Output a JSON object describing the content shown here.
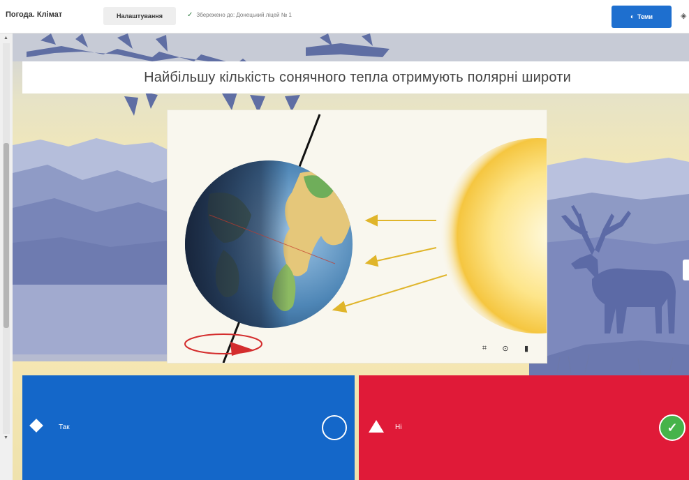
{
  "app": {
    "title": "Погода. Клімат",
    "settings_label": "Налаштування",
    "saved_status": "Збережено до: Донецький ліцей № 1",
    "themes_label": "Теми"
  },
  "slide": {
    "question": "Найбільшу кількість сонячного тепла отримують полярні широти"
  },
  "answers": [
    {
      "label": "Так",
      "shape": "diamond",
      "correct": false
    },
    {
      "label": "Ні",
      "shape": "triangle",
      "correct": true
    }
  ],
  "colors": {
    "answer_a": "#1467c9",
    "answer_b": "#e01a38",
    "themes_button": "#1e6fcf",
    "correct": "#46b34a"
  },
  "icons": {
    "saved": "check-icon",
    "themes": "palette-icon",
    "crop": "crop-icon",
    "info": "info-icon",
    "delete": "trash-icon"
  }
}
